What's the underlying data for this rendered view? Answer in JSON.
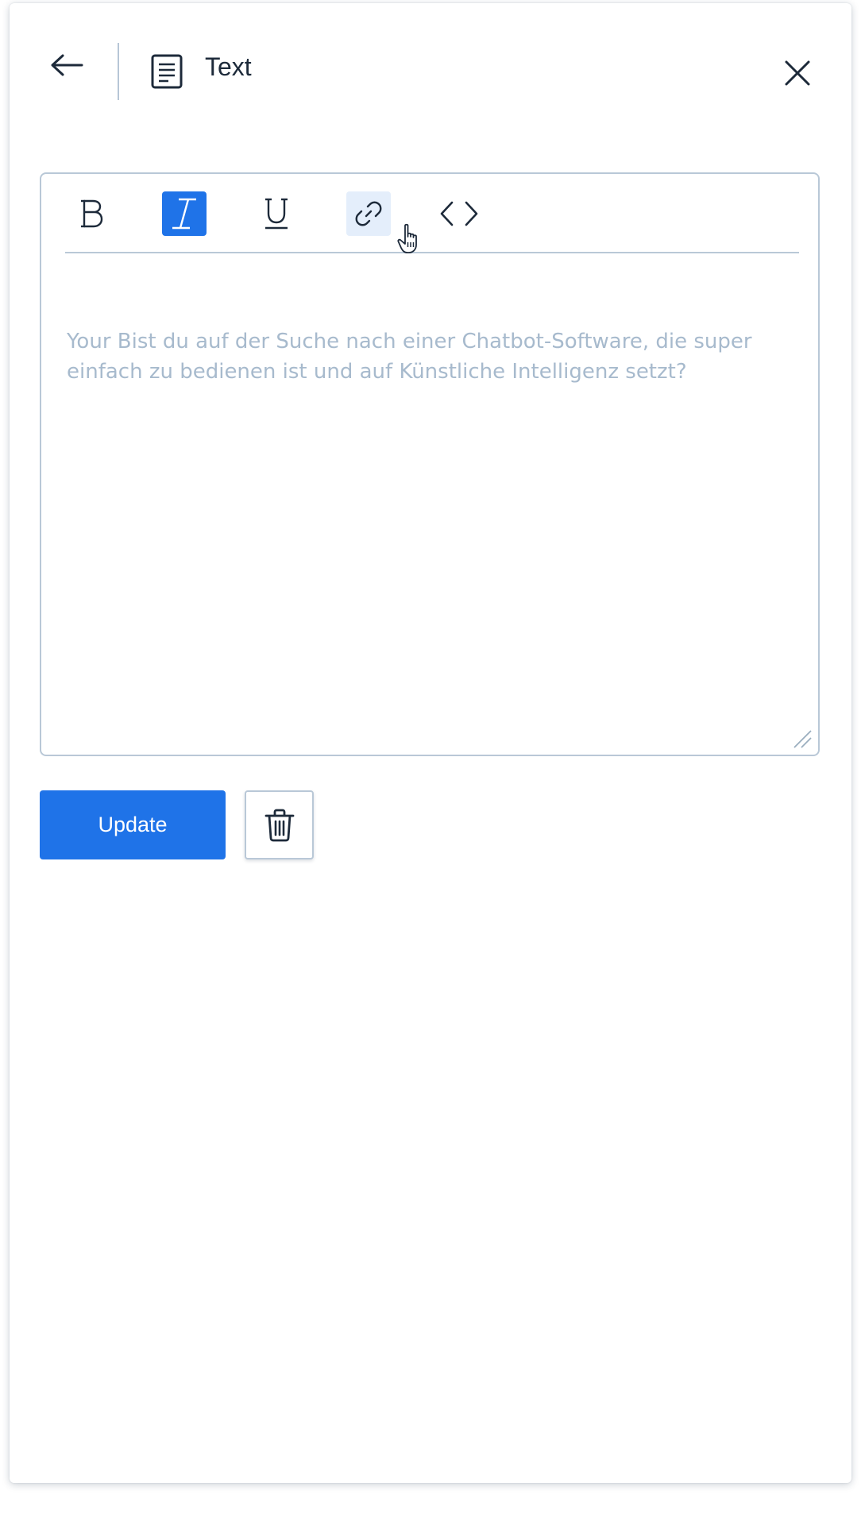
{
  "header": {
    "title": "Text",
    "back_icon": "arrow-left-icon",
    "type_icon": "document-text-icon",
    "close_icon": "close-icon"
  },
  "toolbar": {
    "buttons": [
      {
        "name": "bold",
        "label": "B",
        "icon": "bold-icon",
        "active": false
      },
      {
        "name": "italic",
        "label": "I",
        "icon": "italic-icon",
        "active": true
      },
      {
        "name": "underline",
        "label": "U",
        "icon": "underline-icon",
        "active": false
      },
      {
        "name": "link",
        "icon": "link-icon",
        "hovered": true
      },
      {
        "name": "code",
        "icon": "code-icon",
        "active": false
      }
    ]
  },
  "editor": {
    "placeholder": "Your Bist du auf der Suche nach einer Chatbot-Software, die super einfach zu bedienen ist und auf Künstliche Intelligenz setzt?"
  },
  "actions": {
    "update_label": "Update",
    "delete_icon": "trash-icon"
  },
  "colors": {
    "accent": "#1f73e8",
    "hover_bg": "#e4eefb",
    "border": "#b9c8d7",
    "placeholder_text": "#a7bacd",
    "title_text": "#1d2a3a"
  }
}
